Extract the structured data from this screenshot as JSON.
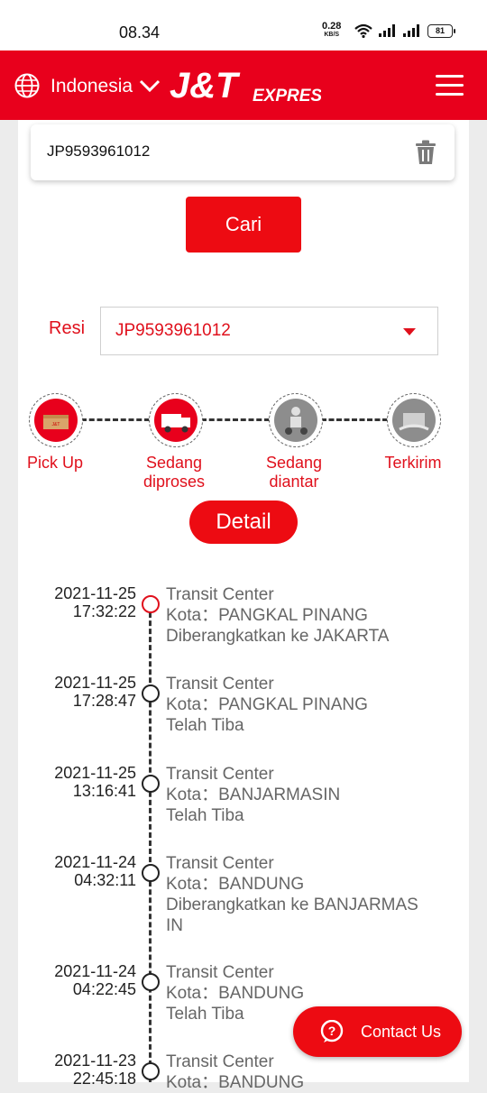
{
  "status_bar": {
    "time": "08.34",
    "net_speed": "0.28",
    "net_unit": "KB/S",
    "battery": "81"
  },
  "header": {
    "country": "Indonesia",
    "logo_main": "J&T",
    "logo_sub": "EXPRESS"
  },
  "search": {
    "value": "JP9593961012",
    "button_label": "Cari"
  },
  "resi": {
    "label": "Resi",
    "selected": "JP9593961012"
  },
  "stages": [
    {
      "label1": "Pick Up",
      "label2": "",
      "active": true
    },
    {
      "label1": "Sedang",
      "label2": "diproses",
      "active": true
    },
    {
      "label1": "Sedang",
      "label2": "diantar",
      "active": false
    },
    {
      "label1": "Terkirim",
      "label2": "",
      "active": false
    }
  ],
  "detail_label": "Detail",
  "tracking": [
    {
      "date": "2021-11-25",
      "time": "17:32:22",
      "title": "Transit Center",
      "city_prefix": "Kota：",
      "city": "PANGKAL PINANG",
      "status": "Diberangkatkan ke JAKARTA"
    },
    {
      "date": "2021-11-25",
      "time": "17:28:47",
      "title": "Transit Center",
      "city_prefix": "Kota：",
      "city": "PANGKAL PINANG",
      "status": "Telah Tiba"
    },
    {
      "date": "2021-11-25",
      "time": "13:16:41",
      "title": "Transit Center",
      "city_prefix": "Kota：",
      "city": "BANJARMASIN",
      "status": "Telah Tiba"
    },
    {
      "date": "2021-11-24",
      "time": "04:32:11",
      "title": "Transit Center",
      "city_prefix": "Kota：",
      "city": "BANDUNG",
      "status": "Diberangkatkan ke BANJARMAS",
      "status2": "IN"
    },
    {
      "date": "2021-11-24",
      "time": "04:22:45",
      "title": "Transit Center",
      "city_prefix": "Kota：",
      "city": "BANDUNG",
      "status": "Telah Tiba"
    },
    {
      "date": "2021-11-23",
      "time": "22:45:18",
      "title": "Transit Center",
      "city_prefix": "Kota：",
      "city": "BANDUNG",
      "status": ""
    }
  ],
  "contact_label": "Contact Us",
  "colors": {
    "brand_red": "#e8001c",
    "button_red": "#ed0b12"
  }
}
